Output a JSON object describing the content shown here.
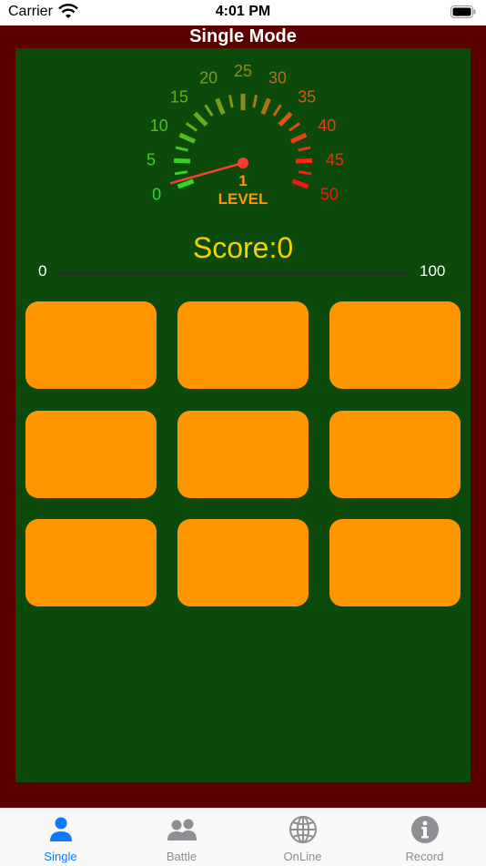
{
  "status_bar": {
    "carrier": "Carrier",
    "time": "4:01 PM"
  },
  "header": {
    "title": "Single Mode"
  },
  "gauge": {
    "scale_labels": [
      "0",
      "5",
      "10",
      "15",
      "20",
      "25",
      "30",
      "35",
      "40",
      "45",
      "50"
    ],
    "level_value": "1",
    "level_label": "LEVEL",
    "needle_value": 1
  },
  "score": {
    "text": "Score:0",
    "progress_min": "0",
    "progress_max": "100",
    "progress_value": 0
  },
  "tiles": [
    {
      "id": "tile-1"
    },
    {
      "id": "tile-2"
    },
    {
      "id": "tile-3"
    },
    {
      "id": "tile-4"
    },
    {
      "id": "tile-5"
    },
    {
      "id": "tile-6"
    },
    {
      "id": "tile-7"
    },
    {
      "id": "tile-8"
    },
    {
      "id": "tile-9"
    }
  ],
  "tabs": [
    {
      "label": "Single",
      "icon": "person-icon",
      "active": true
    },
    {
      "label": "Battle",
      "icon": "two-people-icon",
      "active": false
    },
    {
      "label": "OnLine",
      "icon": "globe-icon",
      "active": false
    },
    {
      "label": "Record",
      "icon": "info-icon",
      "active": false
    }
  ],
  "colors": {
    "frame": "#5b0000",
    "board": "#0b4a0b",
    "tile": "#ff9500",
    "score": "#f5d000",
    "level": "#ff9500",
    "tab_active": "#0a7aff",
    "tab_inactive": "#8e8e93"
  }
}
